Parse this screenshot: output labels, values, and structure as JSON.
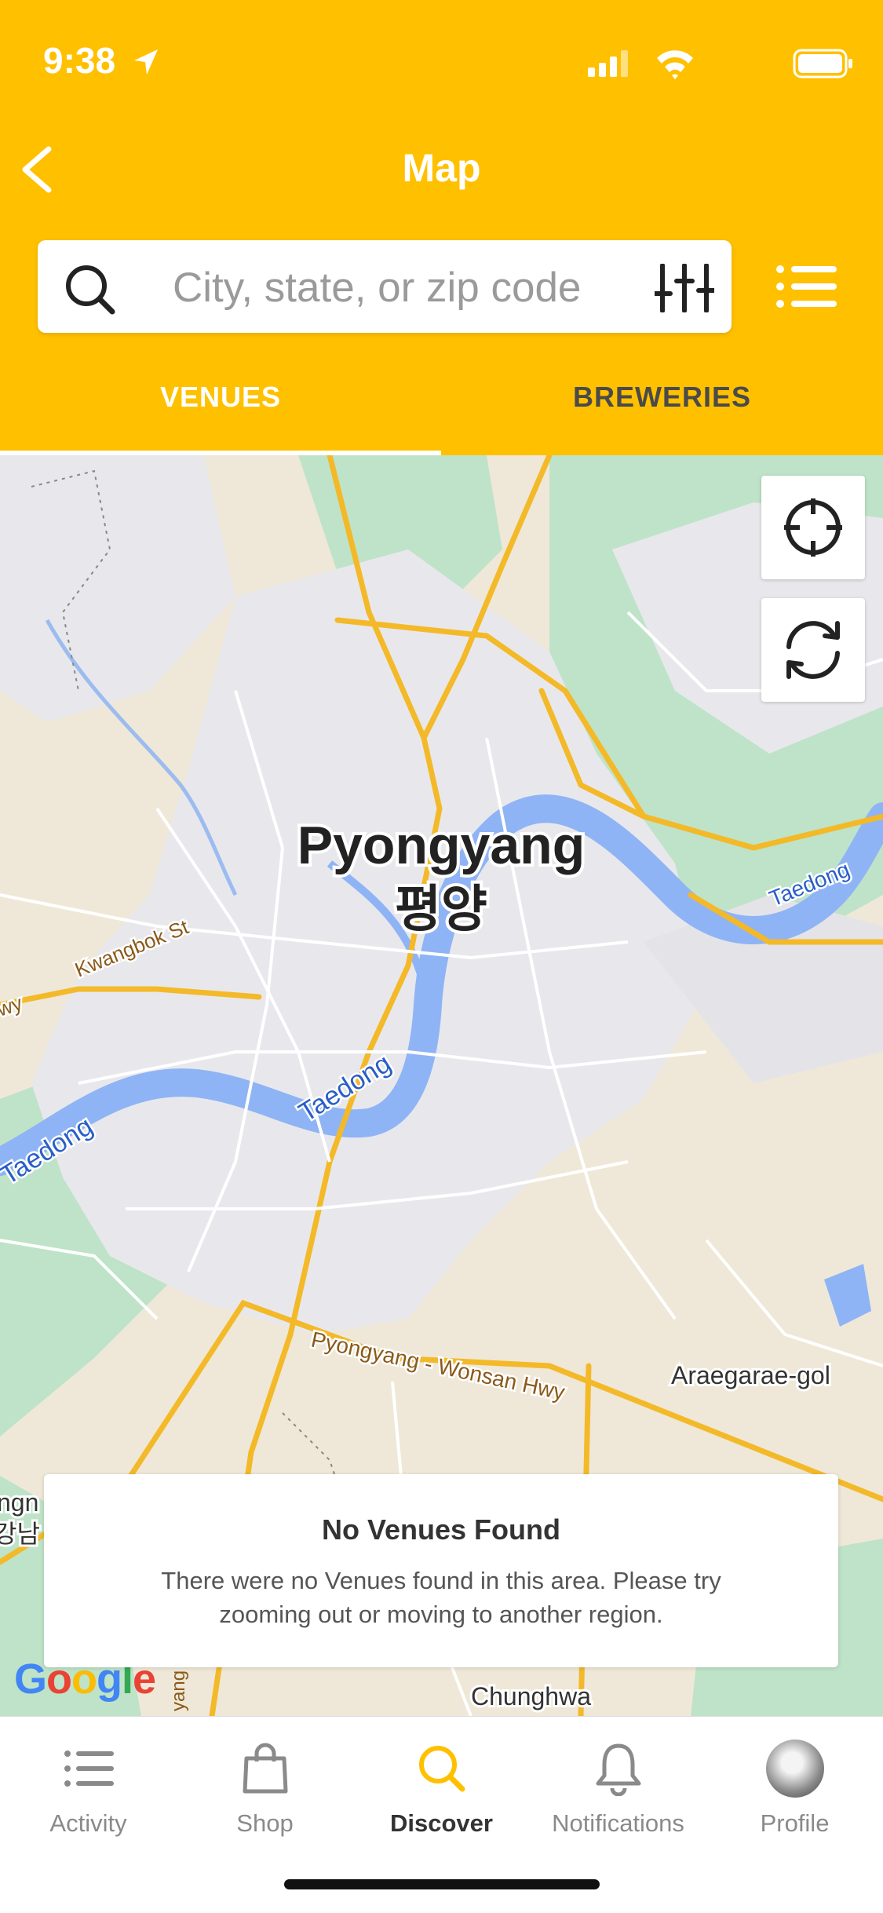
{
  "status": {
    "time": "9:38"
  },
  "header": {
    "title": "Map"
  },
  "search": {
    "placeholder": "City, state, or zip code"
  },
  "tabs": [
    {
      "label": "VENUES",
      "active": true
    },
    {
      "label": "BREWERIES",
      "active": false
    }
  ],
  "map": {
    "city_name": "Pyongyang",
    "city_name_korean": "평양",
    "labels": {
      "kwangbok": "Kwangbok St",
      "wy": "wy",
      "taedong_west": "Taedong",
      "taedong_center": "Taedong",
      "taedong_east": "Taedong",
      "highway": "Pyongyang - Wonsan Hwy",
      "araegarae": "Araegarae-gol",
      "chunghwa": "Chunghwa",
      "left_edge_1": "ngn",
      "left_edge_2": "강남",
      "yang_vertical": "yang"
    },
    "attribution": "Google"
  },
  "empty_state": {
    "title": "No Venues Found",
    "message": "There were no Venues found in this area. Please try zooming out or moving to another region."
  },
  "tabbar": [
    {
      "label": "Activity",
      "icon": "list-icon"
    },
    {
      "label": "Shop",
      "icon": "shopping-bag-icon"
    },
    {
      "label": "Discover",
      "icon": "search-icon",
      "active": true
    },
    {
      "label": "Notifications",
      "icon": "bell-icon"
    },
    {
      "label": "Profile",
      "icon": "avatar"
    }
  ],
  "colors": {
    "brand": "#FFC000",
    "map_land": "#EFE8D8",
    "map_urban": "#E8E8EC",
    "map_park": "#BFE3C8",
    "map_water": "#8FB4F5",
    "map_road": "#F3B928"
  }
}
